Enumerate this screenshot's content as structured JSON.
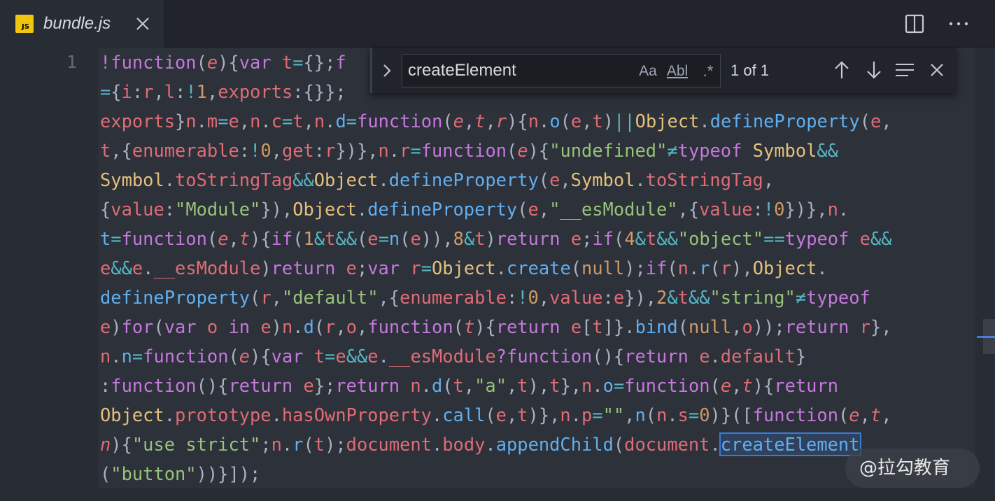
{
  "tab": {
    "title": "bundle.js",
    "icon_label": "JS",
    "icon_color": "#f1c40f"
  },
  "find": {
    "query": "createElement",
    "options": {
      "match_case": "Aa",
      "whole_word": "Abl",
      "regex": ".*"
    },
    "result": "1 of 1"
  },
  "gutter": {
    "line_number": "1"
  },
  "code_lines": [
    [
      [
        "kw",
        "!function"
      ],
      [
        "tx",
        "("
      ],
      [
        "pa",
        "e"
      ],
      [
        "tx",
        "){"
      ],
      [
        "kw",
        "var"
      ],
      [
        "tx",
        " "
      ],
      [
        "vr",
        "t"
      ],
      [
        "op",
        "="
      ],
      [
        "tx",
        "{};"
      ],
      [
        "kw",
        "f"
      ]
    ],
    [
      [
        "op",
        "="
      ],
      [
        "tx",
        "{"
      ],
      [
        "vr",
        "i"
      ],
      [
        "tx",
        ":"
      ],
      [
        "vr",
        "r"
      ],
      [
        "tx",
        ","
      ],
      [
        "vr",
        "l"
      ],
      [
        "tx",
        ":"
      ],
      [
        "op",
        "!"
      ],
      [
        "nm",
        "1"
      ],
      [
        "tx",
        ","
      ],
      [
        "vr",
        "exports"
      ],
      [
        "tx",
        ":{}};"
      ]
    ],
    [
      [
        "vr",
        "exports"
      ],
      [
        "tx",
        "}"
      ],
      [
        "vr",
        "n"
      ],
      [
        "tx",
        "."
      ],
      [
        "vr",
        "m"
      ],
      [
        "op",
        "="
      ],
      [
        "vr",
        "e"
      ],
      [
        "tx",
        ","
      ],
      [
        "vr",
        "n"
      ],
      [
        "tx",
        "."
      ],
      [
        "vr",
        "c"
      ],
      [
        "op",
        "="
      ],
      [
        "vr",
        "t"
      ],
      [
        "tx",
        ","
      ],
      [
        "vr",
        "n"
      ],
      [
        "tx",
        "."
      ],
      [
        "fn",
        "d"
      ],
      [
        "op",
        "="
      ],
      [
        "kw",
        "function"
      ],
      [
        "tx",
        "("
      ],
      [
        "pa",
        "e"
      ],
      [
        "tx",
        ","
      ],
      [
        "pa",
        "t"
      ],
      [
        "tx",
        ","
      ],
      [
        "pa",
        "r"
      ],
      [
        "tx",
        "){"
      ],
      [
        "vr",
        "n"
      ],
      [
        "tx",
        "."
      ],
      [
        "fn",
        "o"
      ],
      [
        "tx",
        "("
      ],
      [
        "vr",
        "e"
      ],
      [
        "tx",
        ","
      ],
      [
        "vr",
        "t"
      ],
      [
        "tx",
        ")"
      ],
      [
        "op",
        "||"
      ],
      [
        "cls",
        "Object"
      ],
      [
        "tx",
        "."
      ],
      [
        "fn",
        "defineProperty"
      ],
      [
        "tx",
        "("
      ],
      [
        "vr",
        "e"
      ],
      [
        "tx",
        ","
      ]
    ],
    [
      [
        "vr",
        "t"
      ],
      [
        "tx",
        ",{"
      ],
      [
        "vr",
        "enumerable"
      ],
      [
        "tx",
        ":"
      ],
      [
        "op",
        "!"
      ],
      [
        "nm",
        "0"
      ],
      [
        "tx",
        ","
      ],
      [
        "vr",
        "get"
      ],
      [
        "tx",
        ":"
      ],
      [
        "vr",
        "r"
      ],
      [
        "tx",
        "})},"
      ],
      [
        "vr",
        "n"
      ],
      [
        "tx",
        "."
      ],
      [
        "vr",
        "r"
      ],
      [
        "op",
        "="
      ],
      [
        "kw",
        "function"
      ],
      [
        "tx",
        "("
      ],
      [
        "pa",
        "e"
      ],
      [
        "tx",
        "){"
      ],
      [
        "st",
        "\"undefined\""
      ],
      [
        "op",
        "≠"
      ],
      [
        "kw",
        "typeof"
      ],
      [
        "tx",
        " "
      ],
      [
        "cls",
        "Symbol"
      ],
      [
        "op",
        "&&"
      ]
    ],
    [
      [
        "cls",
        "Symbol"
      ],
      [
        "tx",
        "."
      ],
      [
        "vr",
        "toStringTag"
      ],
      [
        "op",
        "&&"
      ],
      [
        "cls",
        "Object"
      ],
      [
        "tx",
        "."
      ],
      [
        "fn",
        "defineProperty"
      ],
      [
        "tx",
        "("
      ],
      [
        "vr",
        "e"
      ],
      [
        "tx",
        ","
      ],
      [
        "cls",
        "Symbol"
      ],
      [
        "tx",
        "."
      ],
      [
        "vr",
        "toStringTag"
      ],
      [
        "tx",
        ","
      ]
    ],
    [
      [
        "tx",
        "{"
      ],
      [
        "vr",
        "value"
      ],
      [
        "tx",
        ":"
      ],
      [
        "st",
        "\"Module\""
      ],
      [
        "tx",
        "}),"
      ],
      [
        "cls",
        "Object"
      ],
      [
        "tx",
        "."
      ],
      [
        "fn",
        "defineProperty"
      ],
      [
        "tx",
        "("
      ],
      [
        "vr",
        "e"
      ],
      [
        "tx",
        ","
      ],
      [
        "st",
        "\"__esModule\""
      ],
      [
        "tx",
        ",{"
      ],
      [
        "vr",
        "value"
      ],
      [
        "tx",
        ":"
      ],
      [
        "op",
        "!"
      ],
      [
        "nm",
        "0"
      ],
      [
        "tx",
        "})},"
      ],
      [
        "vr",
        "n"
      ],
      [
        "tx",
        "."
      ]
    ],
    [
      [
        "fn",
        "t"
      ],
      [
        "op",
        "="
      ],
      [
        "kw",
        "function"
      ],
      [
        "tx",
        "("
      ],
      [
        "pa",
        "e"
      ],
      [
        "tx",
        ","
      ],
      [
        "pa",
        "t"
      ],
      [
        "tx",
        "){"
      ],
      [
        "kw",
        "if"
      ],
      [
        "tx",
        "("
      ],
      [
        "nm",
        "1"
      ],
      [
        "op",
        "&"
      ],
      [
        "vr",
        "t"
      ],
      [
        "op",
        "&&"
      ],
      [
        "tx",
        "("
      ],
      [
        "vr",
        "e"
      ],
      [
        "op",
        "="
      ],
      [
        "fn",
        "n"
      ],
      [
        "tx",
        "("
      ],
      [
        "vr",
        "e"
      ],
      [
        "tx",
        ")),"
      ],
      [
        "nm",
        "8"
      ],
      [
        "op",
        "&"
      ],
      [
        "vr",
        "t"
      ],
      [
        "tx",
        ")"
      ],
      [
        "kw",
        "return"
      ],
      [
        "tx",
        " "
      ],
      [
        "vr",
        "e"
      ],
      [
        "tx",
        ";"
      ],
      [
        "kw",
        "if"
      ],
      [
        "tx",
        "("
      ],
      [
        "nm",
        "4"
      ],
      [
        "op",
        "&"
      ],
      [
        "vr",
        "t"
      ],
      [
        "op",
        "&&"
      ],
      [
        "st",
        "\"object\""
      ],
      [
        "op",
        "=="
      ],
      [
        "kw",
        "typeof"
      ],
      [
        "tx",
        " "
      ],
      [
        "vr",
        "e"
      ],
      [
        "op",
        "&&"
      ]
    ],
    [
      [
        "vr",
        "e"
      ],
      [
        "op",
        "&&"
      ],
      [
        "vr",
        "e"
      ],
      [
        "tx",
        "."
      ],
      [
        "vr",
        "__esModule"
      ],
      [
        "tx",
        ")"
      ],
      [
        "kw",
        "return"
      ],
      [
        "tx",
        " "
      ],
      [
        "vr",
        "e"
      ],
      [
        "tx",
        ";"
      ],
      [
        "kw",
        "var"
      ],
      [
        "tx",
        " "
      ],
      [
        "vr",
        "r"
      ],
      [
        "op",
        "="
      ],
      [
        "cls",
        "Object"
      ],
      [
        "tx",
        "."
      ],
      [
        "fn",
        "create"
      ],
      [
        "tx",
        "("
      ],
      [
        "nm",
        "null"
      ],
      [
        "tx",
        ");"
      ],
      [
        "kw",
        "if"
      ],
      [
        "tx",
        "("
      ],
      [
        "vr",
        "n"
      ],
      [
        "tx",
        "."
      ],
      [
        "fn",
        "r"
      ],
      [
        "tx",
        "("
      ],
      [
        "vr",
        "r"
      ],
      [
        "tx",
        "),"
      ],
      [
        "cls",
        "Object"
      ],
      [
        "tx",
        "."
      ]
    ],
    [
      [
        "fn",
        "defineProperty"
      ],
      [
        "tx",
        "("
      ],
      [
        "vr",
        "r"
      ],
      [
        "tx",
        ","
      ],
      [
        "st",
        "\"default\""
      ],
      [
        "tx",
        ",{"
      ],
      [
        "vr",
        "enumerable"
      ],
      [
        "tx",
        ":"
      ],
      [
        "op",
        "!"
      ],
      [
        "nm",
        "0"
      ],
      [
        "tx",
        ","
      ],
      [
        "vr",
        "value"
      ],
      [
        "tx",
        ":"
      ],
      [
        "vr",
        "e"
      ],
      [
        "tx",
        "}),"
      ],
      [
        "nm",
        "2"
      ],
      [
        "op",
        "&"
      ],
      [
        "vr",
        "t"
      ],
      [
        "op",
        "&&"
      ],
      [
        "st",
        "\"string\""
      ],
      [
        "op",
        "≠"
      ],
      [
        "kw",
        "typeof"
      ]
    ],
    [
      [
        "vr",
        "e"
      ],
      [
        "tx",
        ")"
      ],
      [
        "kw",
        "for"
      ],
      [
        "tx",
        "("
      ],
      [
        "kw",
        "var"
      ],
      [
        "tx",
        " "
      ],
      [
        "vr",
        "o"
      ],
      [
        "tx",
        " "
      ],
      [
        "kw",
        "in"
      ],
      [
        "tx",
        " "
      ],
      [
        "vr",
        "e"
      ],
      [
        "tx",
        ")"
      ],
      [
        "vr",
        "n"
      ],
      [
        "tx",
        "."
      ],
      [
        "fn",
        "d"
      ],
      [
        "tx",
        "("
      ],
      [
        "vr",
        "r"
      ],
      [
        "tx",
        ","
      ],
      [
        "vr",
        "o"
      ],
      [
        "tx",
        ","
      ],
      [
        "kw",
        "function"
      ],
      [
        "tx",
        "("
      ],
      [
        "pa",
        "t"
      ],
      [
        "tx",
        "){"
      ],
      [
        "kw",
        "return"
      ],
      [
        "tx",
        " "
      ],
      [
        "vr",
        "e"
      ],
      [
        "tx",
        "["
      ],
      [
        "vr",
        "t"
      ],
      [
        "tx",
        "]}."
      ],
      [
        "fn",
        "bind"
      ],
      [
        "tx",
        "("
      ],
      [
        "nm",
        "null"
      ],
      [
        "tx",
        ","
      ],
      [
        "vr",
        "o"
      ],
      [
        "tx",
        "));"
      ],
      [
        "kw",
        "return"
      ],
      [
        "tx",
        " "
      ],
      [
        "vr",
        "r"
      ],
      [
        "tx",
        "},"
      ]
    ],
    [
      [
        "vr",
        "n"
      ],
      [
        "tx",
        "."
      ],
      [
        "fn",
        "n"
      ],
      [
        "op",
        "="
      ],
      [
        "kw",
        "function"
      ],
      [
        "tx",
        "("
      ],
      [
        "pa",
        "e"
      ],
      [
        "tx",
        "){"
      ],
      [
        "kw",
        "var"
      ],
      [
        "tx",
        " "
      ],
      [
        "vr",
        "t"
      ],
      [
        "op",
        "="
      ],
      [
        "vr",
        "e"
      ],
      [
        "op",
        "&&"
      ],
      [
        "vr",
        "e"
      ],
      [
        "tx",
        "."
      ],
      [
        "vr",
        "__esModule"
      ],
      [
        "kw",
        "?function"
      ],
      [
        "tx",
        "(){"
      ],
      [
        "kw",
        "return"
      ],
      [
        "tx",
        " "
      ],
      [
        "vr",
        "e"
      ],
      [
        "tx",
        "."
      ],
      [
        "vr",
        "default"
      ],
      [
        "tx",
        "}"
      ]
    ],
    [
      [
        "tx",
        ":"
      ],
      [
        "kw",
        "function"
      ],
      [
        "tx",
        "(){"
      ],
      [
        "kw",
        "return"
      ],
      [
        "tx",
        " "
      ],
      [
        "vr",
        "e"
      ],
      [
        "tx",
        "};"
      ],
      [
        "kw",
        "return"
      ],
      [
        "tx",
        " "
      ],
      [
        "vr",
        "n"
      ],
      [
        "tx",
        "."
      ],
      [
        "fn",
        "d"
      ],
      [
        "tx",
        "("
      ],
      [
        "vr",
        "t"
      ],
      [
        "tx",
        ","
      ],
      [
        "st",
        "\"a\""
      ],
      [
        "tx",
        ","
      ],
      [
        "vr",
        "t"
      ],
      [
        "tx",
        "),"
      ],
      [
        "vr",
        "t"
      ],
      [
        "tx",
        "},"
      ],
      [
        "vr",
        "n"
      ],
      [
        "tx",
        "."
      ],
      [
        "fn",
        "o"
      ],
      [
        "op",
        "="
      ],
      [
        "kw",
        "function"
      ],
      [
        "tx",
        "("
      ],
      [
        "pa",
        "e"
      ],
      [
        "tx",
        ","
      ],
      [
        "pa",
        "t"
      ],
      [
        "tx",
        "){"
      ],
      [
        "kw",
        "return"
      ]
    ],
    [
      [
        "cls",
        "Object"
      ],
      [
        "tx",
        "."
      ],
      [
        "vr",
        "prototype"
      ],
      [
        "tx",
        "."
      ],
      [
        "vr",
        "hasOwnProperty"
      ],
      [
        "tx",
        "."
      ],
      [
        "fn",
        "call"
      ],
      [
        "tx",
        "("
      ],
      [
        "vr",
        "e"
      ],
      [
        "tx",
        ","
      ],
      [
        "vr",
        "t"
      ],
      [
        "tx",
        ")},"
      ],
      [
        "vr",
        "n"
      ],
      [
        "tx",
        "."
      ],
      [
        "vr",
        "p"
      ],
      [
        "op",
        "="
      ],
      [
        "st",
        "\"\""
      ],
      [
        "tx",
        ","
      ],
      [
        "fn",
        "n"
      ],
      [
        "tx",
        "("
      ],
      [
        "vr",
        "n"
      ],
      [
        "tx",
        "."
      ],
      [
        "vr",
        "s"
      ],
      [
        "op",
        "="
      ],
      [
        "nm",
        "0"
      ],
      [
        "tx",
        ")}(["
      ],
      [
        "kw",
        "function"
      ],
      [
        "tx",
        "("
      ],
      [
        "pa",
        "e"
      ],
      [
        "tx",
        ","
      ],
      [
        "pa",
        "t"
      ],
      [
        "tx",
        ","
      ]
    ],
    [
      [
        "pa",
        "n"
      ],
      [
        "tx",
        "){"
      ],
      [
        "st",
        "\"use strict\""
      ],
      [
        "tx",
        ";"
      ],
      [
        "vr",
        "n"
      ],
      [
        "tx",
        "."
      ],
      [
        "fn",
        "r"
      ],
      [
        "tx",
        "("
      ],
      [
        "vr",
        "t"
      ],
      [
        "tx",
        ");"
      ],
      [
        "vr",
        "document"
      ],
      [
        "tx",
        "."
      ],
      [
        "vr",
        "body"
      ],
      [
        "tx",
        "."
      ],
      [
        "fn",
        "appendChild"
      ],
      [
        "tx",
        "("
      ],
      [
        "vr",
        "document"
      ],
      [
        "tx",
        "."
      ],
      [
        "fn hl",
        "createElement"
      ]
    ],
    [
      [
        "tx",
        "("
      ],
      [
        "st",
        "\"button\""
      ],
      [
        "tx",
        "))}]);"
      ]
    ]
  ],
  "watermark": {
    "text": "@拉勾教育"
  }
}
